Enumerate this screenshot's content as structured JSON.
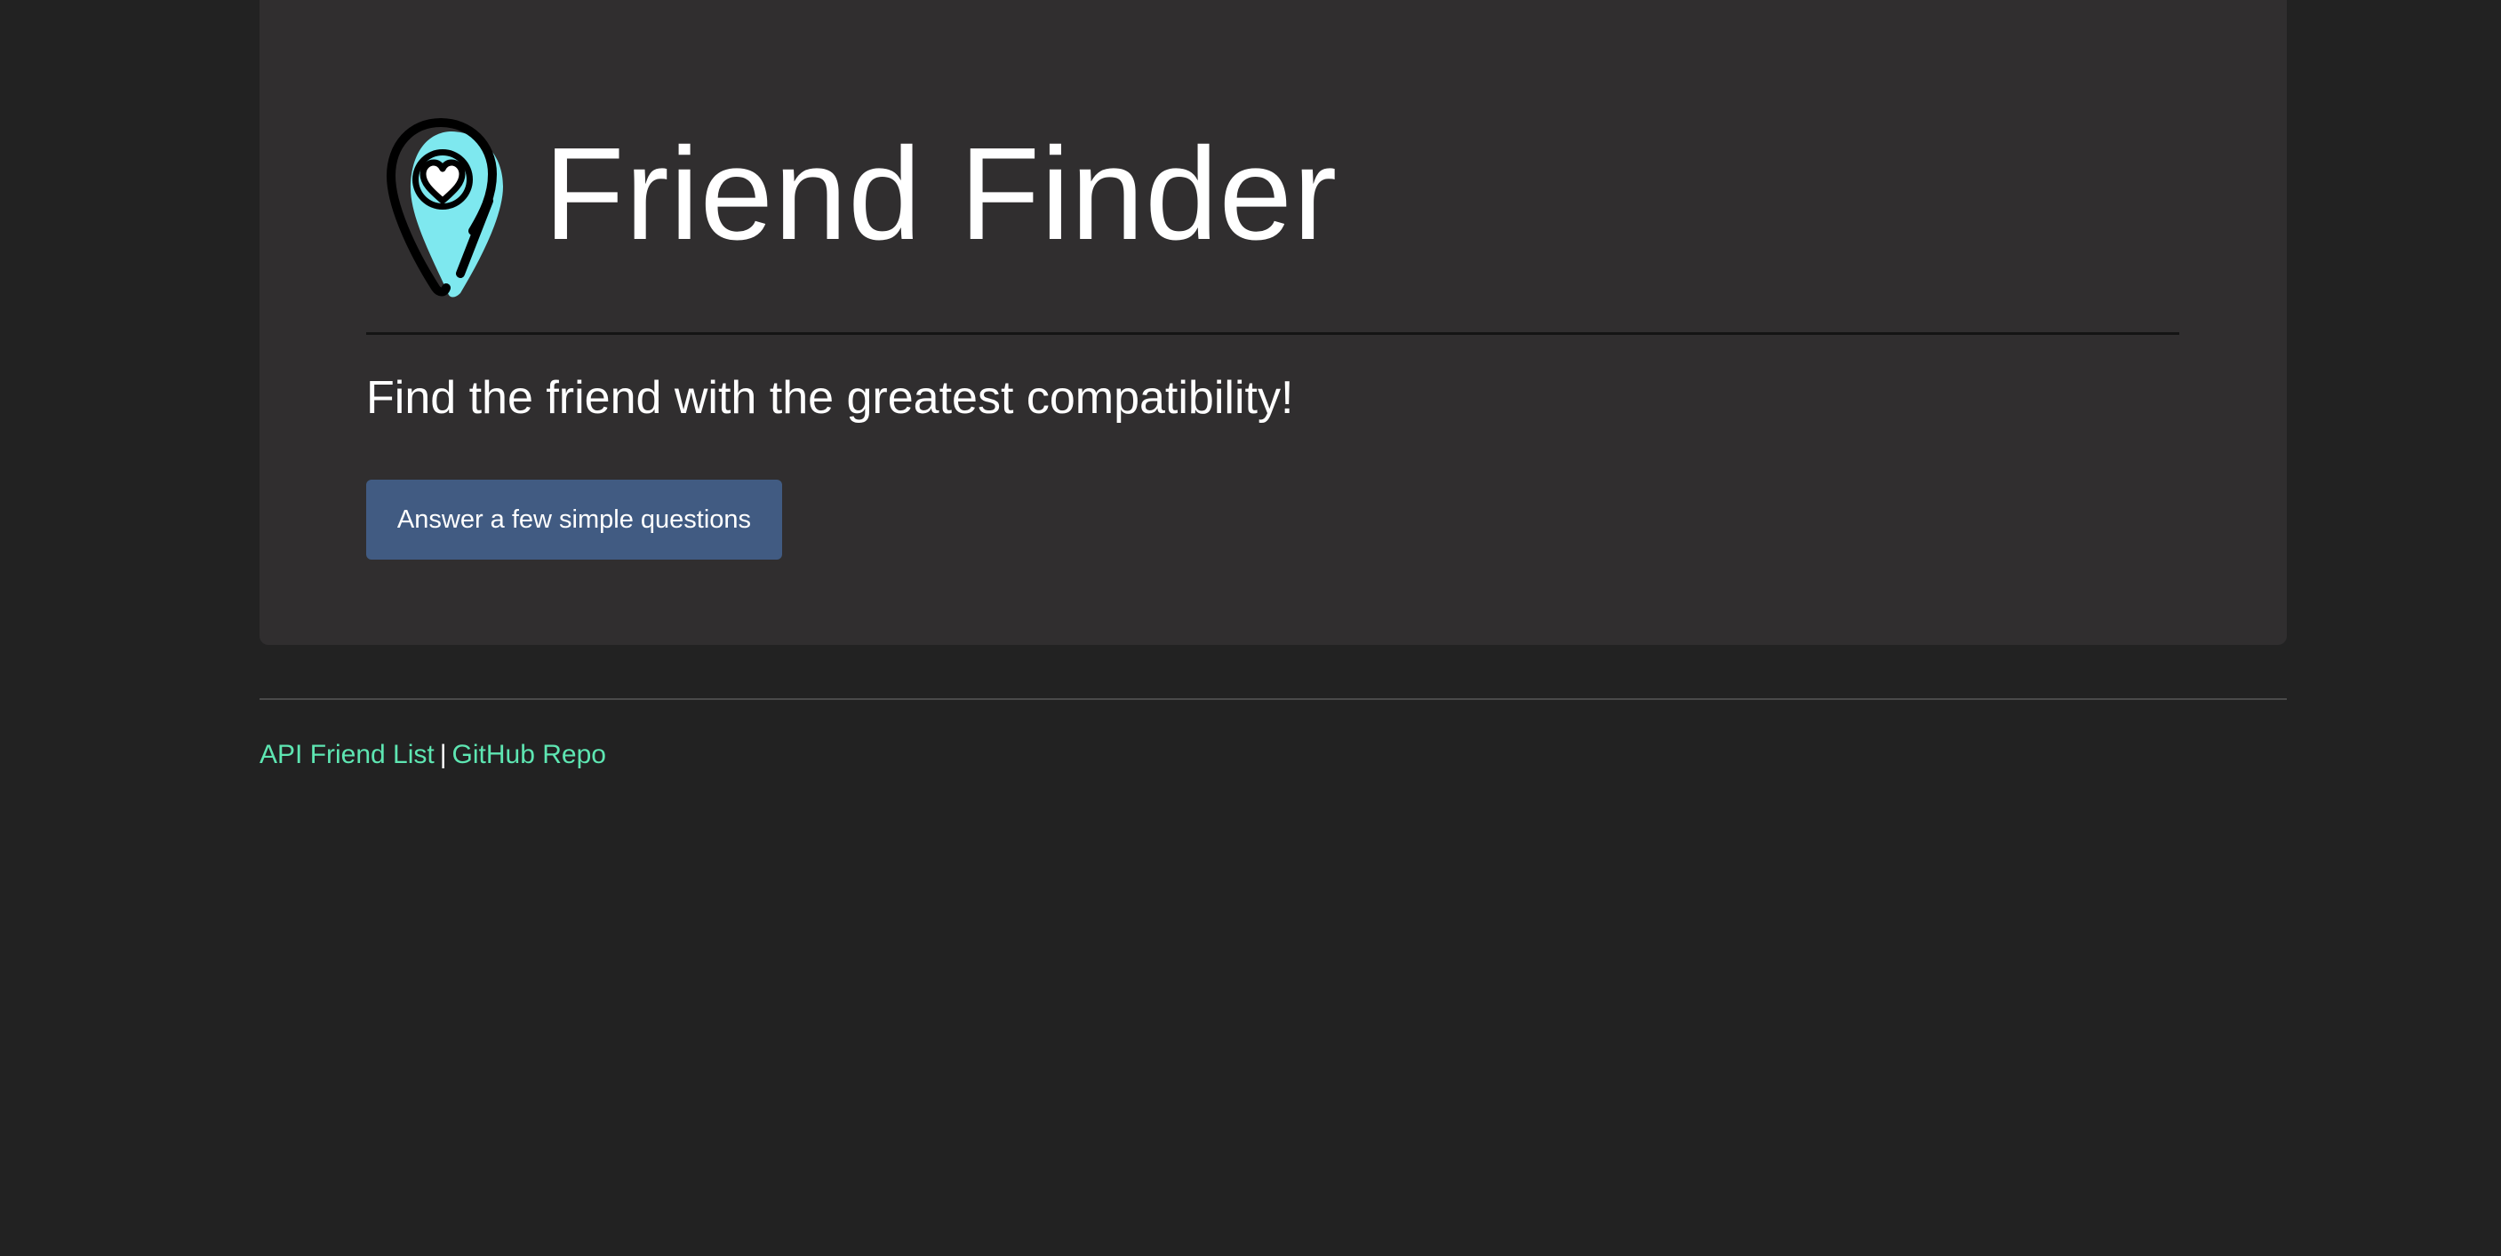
{
  "header": {
    "title": "Friend Finder",
    "icon": "map-pin-heart-icon",
    "icon_color": "#7ee8ef"
  },
  "main": {
    "tagline": "Find the friend with the greatest compatibility!",
    "cta_label": "Answer a few simple questions",
    "cta_color": "#415b82"
  },
  "footer": {
    "links": [
      {
        "label": "API Friend List"
      },
      {
        "label": "GitHub Repo"
      }
    ],
    "separator": "|",
    "link_color": "#5ee6b2"
  },
  "colors": {
    "background": "#222222",
    "panel": "#302e2f",
    "text": "#ffffff"
  }
}
